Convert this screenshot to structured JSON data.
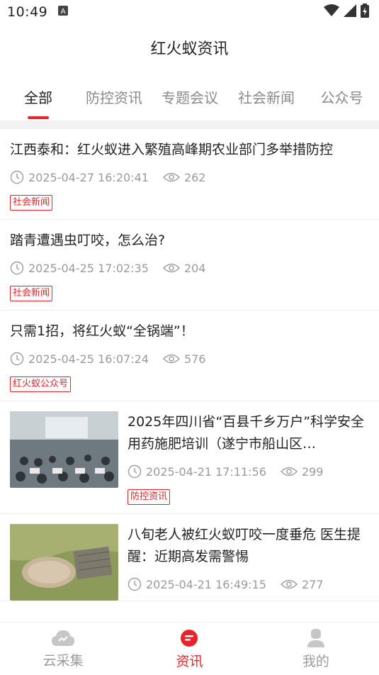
{
  "status": {
    "time": "10:49"
  },
  "header": {
    "title": "红火蚁资讯"
  },
  "tabs": [
    {
      "label": "全部",
      "active": true
    },
    {
      "label": "防控资讯",
      "active": false
    },
    {
      "label": "专题会议",
      "active": false
    },
    {
      "label": "社会新闻",
      "active": false
    },
    {
      "label": "公众号",
      "active": false
    }
  ],
  "articles": [
    {
      "title": "江西泰和：红火蚁进入繁殖高峰期农业部门多举措防控",
      "time": "2025-04-27 16:20:41",
      "views": "262",
      "tag": "社会新闻"
    },
    {
      "title": "踏青遭遇虫叮咬，怎么治?",
      "time": "2025-04-25 17:02:35",
      "views": "204",
      "tag": "社会新闻"
    },
    {
      "title": "只需1招，将红火蚁“全锅端”！",
      "time": "2025-04-25 16:07:24",
      "views": "576",
      "tag": "红火蚁公众号"
    },
    {
      "title": "2025年四川省“百县千乡万户”科学安全用药施肥培训（遂宁市船山区…",
      "time": "2025-04-21 17:11:56",
      "views": "299",
      "tag": "防控资讯"
    },
    {
      "title": "八旬老人被红火蚁叮咬一度垂危 医生提醒：近期高发需警惕",
      "time": "2025-04-21 16:49:15",
      "views": "277",
      "tag": ""
    }
  ],
  "nav": [
    {
      "label": "云采集",
      "icon": "cloud-icon",
      "active": false
    },
    {
      "label": "资讯",
      "icon": "news-icon",
      "active": true
    },
    {
      "label": "我的",
      "icon": "user-icon",
      "active": false
    }
  ],
  "colors": {
    "accent": "#e8232a",
    "muted": "#9a9a9a"
  }
}
